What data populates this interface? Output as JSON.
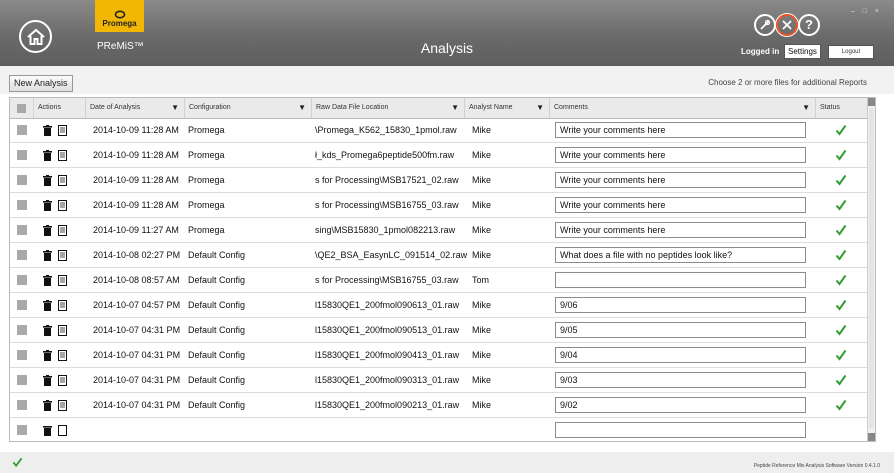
{
  "header": {
    "logo_text": "Promega",
    "app_name": "PReMiS™",
    "title": "Analysis",
    "logged_in_label": "Logged in",
    "settings_label": "Settings",
    "logout_label": "Logout",
    "window_controls": "– □ ×",
    "help_glyph": "?",
    "icons": [
      "home-icon",
      "wrench-circle-icon",
      "tools-circle-icon",
      "help-icon"
    ],
    "accent_color": "#f2b705",
    "active_icon_ring": "#e8562a"
  },
  "toolbar": {
    "new_analysis_label": "New Analysis",
    "hint": "Choose 2 or more files for additional Reports"
  },
  "columns": [
    "Actions",
    "Date of Analysis",
    "Configuration",
    "Raw Data File Location",
    "Analyst Name",
    "Comments",
    "Status"
  ],
  "rows": [
    {
      "date": "2014-10-09 11:28 AM",
      "config": "Promega",
      "file": "\\Promega_K562_15830_1pmol.raw",
      "analyst": "Mike",
      "comment": "Write your comments here"
    },
    {
      "date": "2014-10-09 11:28 AM",
      "config": "Promega",
      "file": "ł_kds_Promega6peptide500fm.raw",
      "analyst": "Mike",
      "comment": "Write your comments here"
    },
    {
      "date": "2014-10-09 11:28 AM",
      "config": "Promega",
      "file": "s for Processing\\MSB17521_02.raw",
      "analyst": "Mike",
      "comment": "Write your comments here"
    },
    {
      "date": "2014-10-09 11:28 AM",
      "config": "Promega",
      "file": "s for Processing\\MSB16755_03.raw",
      "analyst": "Mike",
      "comment": "Write your comments here"
    },
    {
      "date": "2014-10-09 11:27 AM",
      "config": "Promega",
      "file": "sing\\MSB15830_1pmol082213.raw",
      "analyst": "Mike",
      "comment": "Write your comments here"
    },
    {
      "date": "2014-10-08 02:27 PM",
      "config": "Default Config",
      "file": "\\QE2_BSA_EasynLC_091514_02.raw",
      "analyst": "Mike",
      "comment": "What does a file with no peptides look like?"
    },
    {
      "date": "2014-10-08 08:57 AM",
      "config": "Default Config",
      "file": "s for Processing\\MSB16755_03.raw",
      "analyst": "Tom",
      "comment": ""
    },
    {
      "date": "2014-10-07 04:57 PM",
      "config": "Default Config",
      "file": "l15830QE1_200fmol090613_01.raw",
      "analyst": "Mike",
      "comment": "9/06"
    },
    {
      "date": "2014-10-07 04:31 PM",
      "config": "Default Config",
      "file": "l15830QE1_200fmol090513_01.raw",
      "analyst": "Mike",
      "comment": "9/05"
    },
    {
      "date": "2014-10-07 04:31 PM",
      "config": "Default Config",
      "file": "l15830QE1_200fmol090413_01.raw",
      "analyst": "Mike",
      "comment": "9/04"
    },
    {
      "date": "2014-10-07 04:31 PM",
      "config": "Default Config",
      "file": "l15830QE1_200fmol090313_01.raw",
      "analyst": "Mike",
      "comment": "9/03"
    },
    {
      "date": "2014-10-07 04:31 PM",
      "config": "Default Config",
      "file": "l15830QE1_200fmol090213_01.raw",
      "analyst": "Mike",
      "comment": "9/02"
    }
  ],
  "status_color": "#2f9e2f",
  "footer": {
    "version": "Peptide Reference Mix Analysis Software Version 0.4.1.0"
  }
}
